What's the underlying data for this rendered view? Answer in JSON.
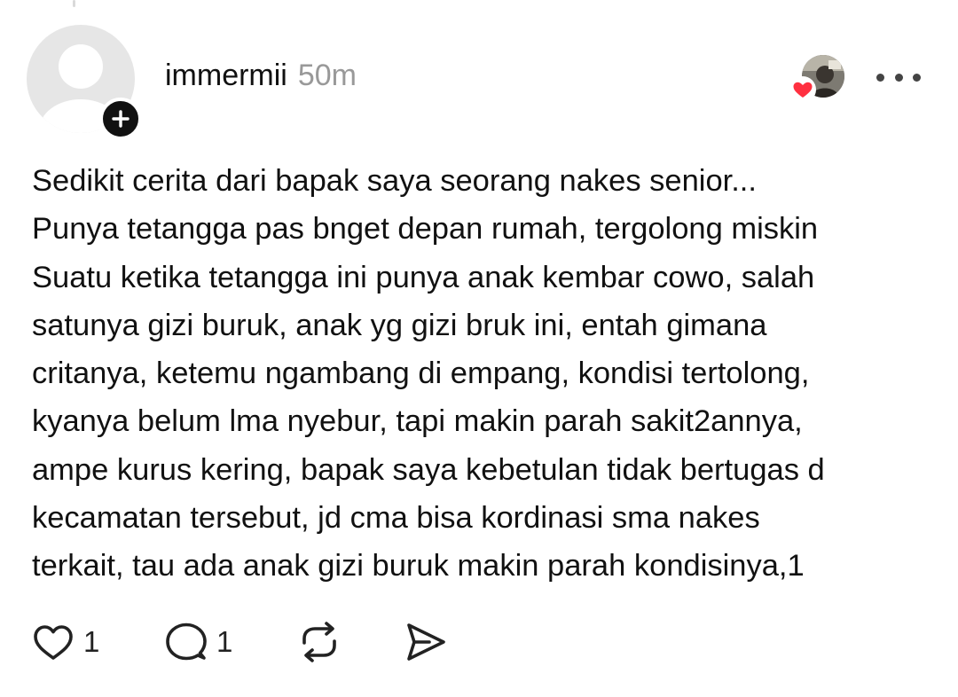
{
  "post": {
    "username": "immermii",
    "timestamp": "50m",
    "text_lines": [
      "Sedikit cerita dari bapak saya seorang nakes senior...",
      "Punya tetangga pas bnget depan rumah, tergolong miskin",
      "Suatu ketika tetangga ini punya anak kembar cowo, salah",
      "satunya gizi buruk, anak yg gizi bruk ini, entah gimana",
      "critanya, ketemu ngambang di empang, kondisi tertolong,",
      "kyanya belum lma nyebur, tapi makin parah sakit2annya,",
      "ampe kurus kering, bapak saya kebetulan tidak bertugas d",
      "kecamatan tersebut, jd cma bisa kordinasi sma nakes",
      "terkait, tau ada anak gizi buruk makin parah kondisinya,1"
    ]
  },
  "actions": {
    "like_count": "1",
    "reply_count": "1"
  },
  "icons": {
    "follow": "plus-icon",
    "liked_badge": "heart-icon",
    "more": "more-horizontal-icon",
    "like": "heart-outline-icon",
    "reply": "speech-bubble-icon",
    "repost": "repost-icon",
    "share": "send-icon"
  },
  "colors": {
    "text": "#111111",
    "timestamp": "#999999",
    "heart_badge": "#ff3040",
    "avatar_placeholder": "#e6e6e6"
  }
}
